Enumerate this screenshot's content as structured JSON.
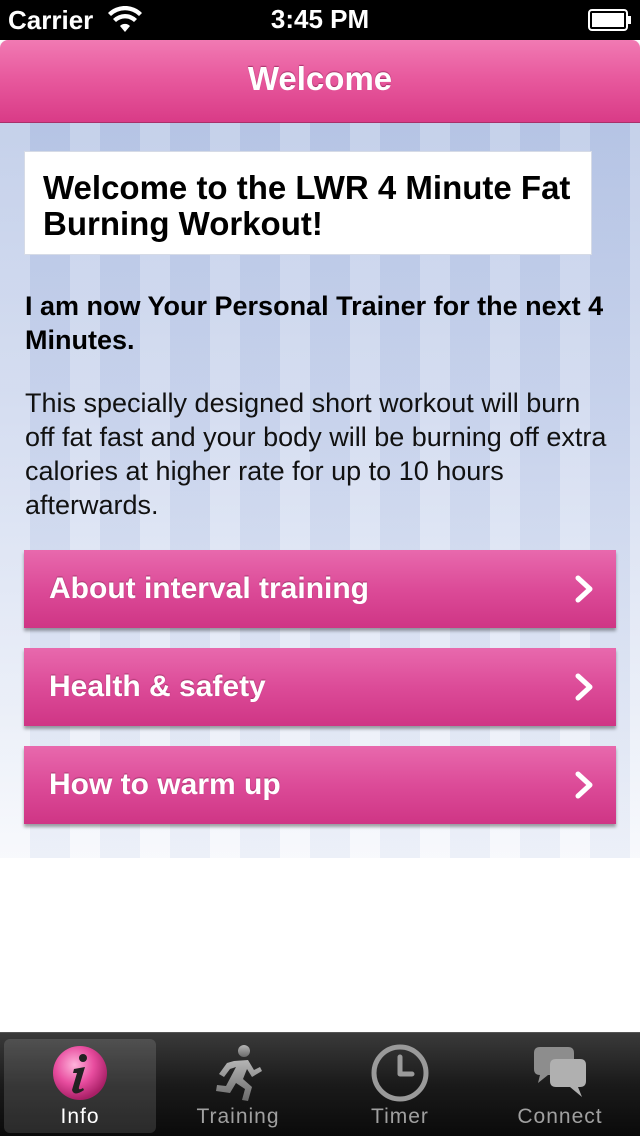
{
  "status_bar": {
    "carrier": "Carrier",
    "time": "3:45 PM",
    "icons": [
      "wifi-icon",
      "battery-icon"
    ]
  },
  "nav": {
    "title": "Welcome"
  },
  "content": {
    "heading": "Welcome to the LWR 4 Minute Fat Burning Workout!",
    "intro_bold": "I am now Your Personal Trainer for the next 4 Minutes.",
    "intro_text": "This specially designed short workout will burn off fat fast and your body will be burning off extra calories at higher rate for up to 10 hours afterwards."
  },
  "menu": [
    {
      "label": "About interval training",
      "icon": "chevron-right-icon"
    },
    {
      "label": "Health & safety",
      "icon": "chevron-right-icon"
    },
    {
      "label": "How to warm up",
      "icon": "chevron-right-icon"
    }
  ],
  "tabs": [
    {
      "label": "Info",
      "icon": "info-icon",
      "selected": true
    },
    {
      "label": "Training",
      "icon": "running-figure-icon",
      "selected": false
    },
    {
      "label": "Timer",
      "icon": "clock-icon",
      "selected": false
    },
    {
      "label": "Connect",
      "icon": "speech-bubbles-icon",
      "selected": false
    }
  ],
  "colors": {
    "accent_pink": "#dc4b98",
    "nav_pink": "#e85a9e",
    "tab_bar": "#1a1a1a"
  }
}
